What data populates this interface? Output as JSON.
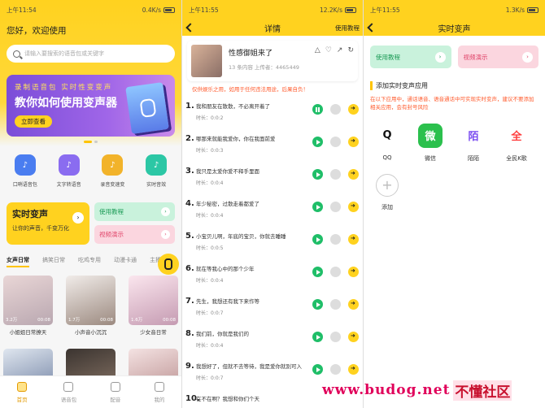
{
  "status": {
    "p1_time": "上午11:54",
    "p1_speed": "0.4K/s",
    "p2_time": "上午11:55",
    "p2_speed": "12.2K/s",
    "p3_time": "上午11:55",
    "p3_speed": "1.3K/s"
  },
  "home": {
    "welcome": "您好，欢迎使用",
    "search_placeholder": "请输入要搜索的语音包或关键字",
    "banner_line1": "录制语音包 实时性变变声",
    "banner_title": "教你如何使用变声器",
    "banner_button": "立即查看",
    "icons": [
      {
        "label": "口哨语音包",
        "icon": "phone-audio-icon",
        "color": "#4a7df0"
      },
      {
        "label": "文字转语音",
        "icon": "text-speech-icon",
        "color": "#8a6cf0"
      },
      {
        "label": "录音变速变",
        "icon": "record-icon",
        "color": "#f2b32a"
      },
      {
        "label": "实时音效",
        "icon": "star-icon",
        "color": "#2cc7a5"
      }
    ],
    "card_title": "实时变声",
    "card_sub": "让你的声音，千变万化",
    "tutorial": "使用教程",
    "video_demo": "视频演示",
    "tabs": [
      "女声日常",
      "搞笑日常",
      "吃鸡专用",
      "动漫卡通",
      "主播专用"
    ],
    "tiles": [
      {
        "name": "小姐姐日常撩天",
        "count": "3.2万",
        "dur": "00:08",
        "grad": "#e9d6d6,#b9a7b0"
      },
      {
        "name": "小声音小沉沉",
        "count": "1.7万",
        "dur": "00:08",
        "grad": "#f1ece9,#9c8a80"
      },
      {
        "name": "少女音日常",
        "count": "1.6万",
        "dur": "00:08",
        "grad": "#fbe6ee,#c59bb2"
      },
      {
        "name": "",
        "count": "",
        "dur": "",
        "grad": "#dfe6ef,#6d7ea0"
      },
      {
        "name": "",
        "count": "",
        "dur": "",
        "grad": "#3b3430,#8c7869"
      },
      {
        "name": "",
        "count": "",
        "dur": "",
        "grad": "#f4e2e2,#b78c8c"
      }
    ],
    "nav": [
      "首页",
      "语音包",
      "配音",
      "我的"
    ]
  },
  "detail": {
    "title": "详情",
    "right_link": "使用教程",
    "pkg_title": "性感御姐来了",
    "pkg_stats": "13 条内容   上传者：4465449",
    "warning": "仅供娱乐之用，如用于任何违法用途，后果自负！",
    "items": [
      {
        "n": "1.",
        "t": "我和朋友在散散，不必离开着了",
        "d": "时长：0:0:2"
      },
      {
        "n": "2.",
        "t": "哪那来就能我爱你，你在我面前爱",
        "d": "时长：0:0:3"
      },
      {
        "n": "3.",
        "t": "我只是太爱你爱不释手里面",
        "d": "时长：0:0:4"
      },
      {
        "n": "4.",
        "t": "年少秘密，过散走着都爱了",
        "d": "时长：0:0:4"
      },
      {
        "n": "5.",
        "t": "小宝贝儿啊，年底的宝贝，你就去睡睡",
        "d": "时长：0:0:5"
      },
      {
        "n": "6.",
        "t": "就在等我心中的那个少年",
        "d": "时长：0:0:4"
      },
      {
        "n": "7.",
        "t": "先生，我想还有我下来作等",
        "d": "时长：0:0:7"
      },
      {
        "n": "8.",
        "t": "我们前，你就是我们的",
        "d": "时长：0:0:4"
      },
      {
        "n": "9.",
        "t": "我想好了，但就不去等待，我是爱你就别可入",
        "d": "时长：0:0:7"
      },
      {
        "n": "10.",
        "t": "在不在啊？我想和你们个天",
        "d": ""
      }
    ]
  },
  "realtime": {
    "title": "实时变声",
    "btn_tutorial": "使用教程",
    "btn_video": "视频演示",
    "section": "添加实时变声应用",
    "note": "在以下应用中，通话语音、语音通话中可实现实时变声，建议不要添加相关应用，会有封号风险",
    "apps": [
      {
        "label": "QQ",
        "icon": "qq-icon",
        "bg": "#ffffff",
        "fg": "#111"
      },
      {
        "label": "微信",
        "icon": "wechat-icon",
        "bg": "#2bc04d",
        "fg": "#fff"
      },
      {
        "label": "陌陌",
        "icon": "momo-icon",
        "bg": "#ffffff",
        "fg": "#7a4cf0"
      },
      {
        "label": "全民K歌",
        "icon": "kge-icon",
        "bg": "#ffffff",
        "fg": "#ff3d3d"
      }
    ],
    "add_label": "添加"
  },
  "watermark": {
    "site": "www.budog.net",
    "brand": "不懂社区"
  }
}
